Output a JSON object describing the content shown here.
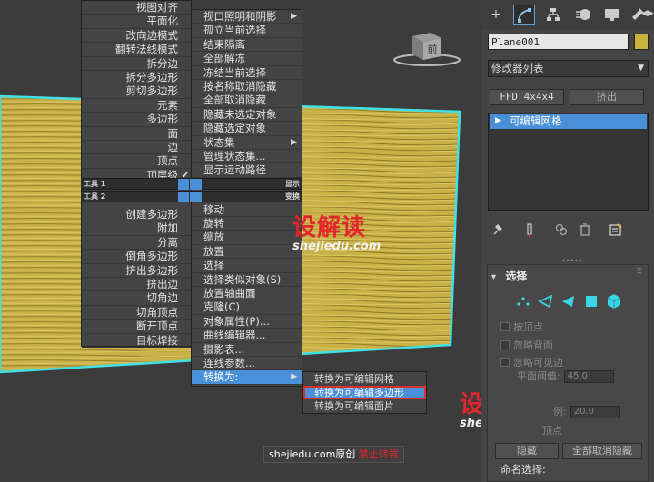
{
  "quad_menu": {
    "left_items": [
      {
        "label": "视图对齐"
      },
      {
        "label": "平面化"
      },
      {
        "label": "改向边模式"
      },
      {
        "label": "翻转法线模式"
      },
      {
        "label": "拆分边"
      },
      {
        "label": "拆分多边形"
      },
      {
        "label": "剪切多边形"
      },
      {
        "label": "元素"
      },
      {
        "label": "多边形"
      },
      {
        "label": "面"
      },
      {
        "label": "边"
      },
      {
        "label": "顶点"
      },
      {
        "label": "顶层级",
        "checked": true
      }
    ],
    "left_items_lower": [
      {
        "label": "创建多边形"
      },
      {
        "label": "附加"
      },
      {
        "label": "分离"
      },
      {
        "label": "倒角多边形"
      },
      {
        "label": "挤出多边形"
      },
      {
        "label": "挤出边"
      },
      {
        "label": "切角边"
      },
      {
        "label": "切角顶点"
      },
      {
        "label": "断开顶点"
      },
      {
        "label": "目标焊接"
      }
    ],
    "right_items": [
      {
        "label": "视口照明和阴影",
        "submenu": true
      },
      {
        "label": "孤立当前选择"
      },
      {
        "label": "结束隔离"
      },
      {
        "label": "全部解冻"
      },
      {
        "label": "冻结当前选择"
      },
      {
        "label": "按名称取消隐藏"
      },
      {
        "label": "全部取消隐藏"
      },
      {
        "label": "隐藏未选定对象"
      },
      {
        "label": "隐藏选定对象"
      },
      {
        "label": "状态集",
        "submenu": true
      },
      {
        "label": "管理状态集..."
      },
      {
        "label": "显示运动路径"
      }
    ],
    "right_items_lower": [
      {
        "label": "移动"
      },
      {
        "label": "旋转"
      },
      {
        "label": "缩放"
      },
      {
        "label": "放置"
      },
      {
        "label": "选择"
      },
      {
        "label": "选择类似对象(S)"
      },
      {
        "label": "放置轴曲面"
      },
      {
        "label": "克隆(C)"
      },
      {
        "label": "对象属性(P)..."
      },
      {
        "label": "曲线编辑器..."
      },
      {
        "label": "摄影表..."
      },
      {
        "label": "连线参数..."
      },
      {
        "label": "转换为:",
        "submenu": true,
        "active": true
      }
    ],
    "bar1": {
      "left": "工具 1",
      "right": "显示"
    },
    "bar2": {
      "left": "工具 2",
      "right": "变换"
    },
    "convert_submenu": [
      {
        "label": "转换为可编辑网格"
      },
      {
        "label": "转换为可编辑多边形",
        "highlighted": true
      },
      {
        "label": "转换为可编辑面片"
      }
    ]
  },
  "viewcube": {
    "label": "前"
  },
  "watermark": {
    "brand": "设解读",
    "url": "shejiedu.com",
    "banner_left": "shejiedu.com原创",
    "banner_right": "禁止转载"
  },
  "command_panel": {
    "tab_icons": [
      "plus-icon",
      "modify-icon",
      "hierarchy-icon",
      "motion-icon",
      "display-icon",
      "utilities-icon"
    ],
    "object_name": "Plane001",
    "object_color": "#c8b43c",
    "modifier_list": "修改器列表",
    "buttons": {
      "ffd": "FFD 4x4x4",
      "extrude": "挤出"
    },
    "stack_item": "可编辑网格",
    "selection_rollout": {
      "title": "选择",
      "by_vertex": "按顶点",
      "ignore_backfacing": "忽略背面",
      "ignore_visible_edges": "忽略可见边",
      "planar_threshold_label": "平面阈值:",
      "planar_threshold_value": "45.0",
      "scale_label": "例:",
      "scale_value": "20.0",
      "vertex_label": "顶点",
      "hide_button": "隐藏",
      "unhide_all_button": "全部取消隐藏",
      "named_selection": "命名选择:"
    }
  }
}
